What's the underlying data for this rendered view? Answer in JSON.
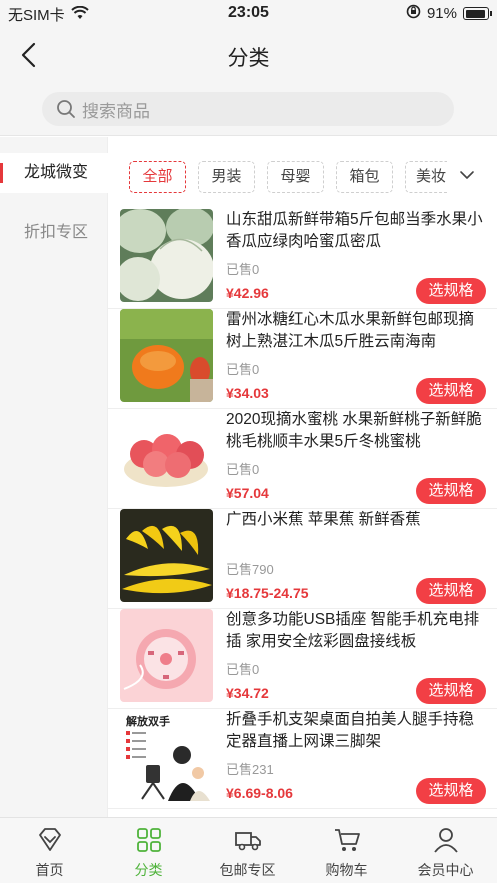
{
  "status_bar": {
    "carrier": "无SIM卡",
    "time": "23:05",
    "battery": "91%"
  },
  "nav": {
    "title": "分类"
  },
  "search": {
    "placeholder": "搜索商品"
  },
  "sidebar": {
    "items": [
      {
        "label": "龙城微变"
      },
      {
        "label": "折扣专区"
      }
    ]
  },
  "filters": {
    "chips": [
      {
        "label": "全部"
      },
      {
        "label": "男装"
      },
      {
        "label": "母婴"
      },
      {
        "label": "箱包"
      },
      {
        "label": "美妆"
      }
    ]
  },
  "products": [
    {
      "title": "山东甜瓜新鲜带箱5斤包邮当季水果小香瓜应绿肉哈蜜瓜密瓜",
      "sold": "已售0",
      "price": "¥42.96",
      "button": "选规格",
      "image": "melon"
    },
    {
      "title": "雷州冰糖红心木瓜水果新鲜包邮现摘树上熟湛江木瓜5斤胜云南海南",
      "sold": "已售0",
      "price": "¥34.03",
      "button": "选规格",
      "image": "papaya"
    },
    {
      "title": "2020现摘水蜜桃 水果新鲜桃子新鲜脆桃毛桃顺丰水果5斤冬桃蜜桃",
      "sold": "已售0",
      "price": "¥57.04",
      "button": "选规格",
      "image": "peach"
    },
    {
      "title": "广西小米蕉 苹果蕉 新鲜香蕉",
      "sold": "已售790",
      "price": "¥18.75-24.75",
      "button": "选规格",
      "image": "banana"
    },
    {
      "title": "创意多功能USB插座 智能手机充电排插 家用安全炫彩圆盘接线板",
      "sold": "已售0",
      "price": "¥34.72",
      "button": "选规格",
      "image": "socket"
    },
    {
      "title": "折叠手机支架桌面自拍美人腿手持稳定器直播上网课三脚架",
      "sold": "已售231",
      "price": "¥6.69-8.06",
      "button": "选规格",
      "image": "tripod",
      "thumb_caption": "解放双手"
    }
  ],
  "tabbar": {
    "items": [
      {
        "label": "首页"
      },
      {
        "label": "分类"
      },
      {
        "label": "包邮专区"
      },
      {
        "label": "购物车"
      },
      {
        "label": "会员中心"
      }
    ]
  },
  "colors": {
    "accent": "#e5383b",
    "tab_active": "#4fb33b",
    "button": "#f23f45"
  }
}
